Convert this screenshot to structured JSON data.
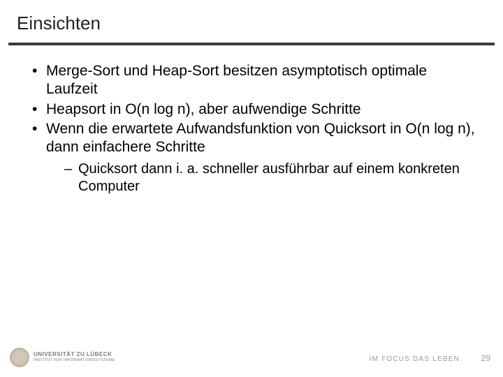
{
  "title": "Einsichten",
  "bullets": [
    {
      "text": "Merge-Sort und Heap-Sort besitzen asymptotisch optimale Laufzeit"
    },
    {
      "text": "Heapsort in O(n log n), aber aufwendige Schritte"
    },
    {
      "text": "Wenn die erwartete Aufwandsfunktion von Quicksort in O(n log n), dann einfachere Schritte",
      "sub": [
        {
          "text": "Quicksort dann i. a. schneller ausführbar auf einem konkreten Computer"
        }
      ]
    }
  ],
  "footer": {
    "university_line1": "UNIVERSITÄT ZU LÜBECK",
    "university_line2": "INSTITUT FÜR INFORMATIONSSYSTEME",
    "tagline": "IM FOCUS DAS LEBEN",
    "page_number": "29"
  }
}
